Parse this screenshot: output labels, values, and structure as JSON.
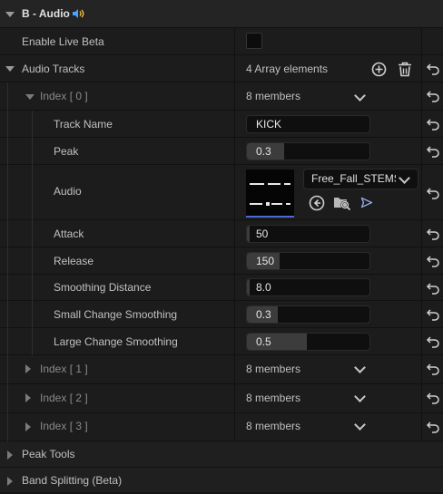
{
  "panel": {
    "section_title": "B - Audio",
    "section_icon": "speaker-icon",
    "enable_live_beta": {
      "label": "Enable Live Beta",
      "checked": false
    },
    "audio_tracks": {
      "label": "Audio Tracks",
      "count_text": "4 Array elements",
      "add_icon": "plus-circle-icon",
      "delete_icon": "trash-icon"
    },
    "index0": {
      "label": "Index [ 0 ]",
      "members": "8 members",
      "track_name": {
        "label": "Track Name",
        "value": "KICK"
      },
      "peak": {
        "label": "Peak",
        "value": "0.3",
        "fill": 0.3
      },
      "audio": {
        "label": "Audio",
        "asset": "Free_Fall_STEMS",
        "icons": [
          "use-selected-icon",
          "browse-folder-icon",
          "play-icon"
        ]
      },
      "attack": {
        "label": "Attack",
        "value": "50",
        "fill": 0.02
      },
      "release": {
        "label": "Release",
        "value": "150",
        "fill": 0.27
      },
      "smoothing_distance": {
        "label": "Smoothing Distance",
        "value": "8.0",
        "fill": 0.02
      },
      "small_change_smoothing": {
        "label": "Small Change Smoothing",
        "value": "0.3",
        "fill": 0.25
      },
      "large_change_smoothing": {
        "label": "Large Change Smoothing",
        "value": "0.5",
        "fill": 0.49
      }
    },
    "index1": {
      "label": "Index [ 1 ]",
      "members": "8 members"
    },
    "index2": {
      "label": "Index [ 2 ]",
      "members": "8 members"
    },
    "index3": {
      "label": "Index [ 3 ]",
      "members": "8 members"
    },
    "peak_tools": {
      "label": "Peak Tools"
    },
    "band_splitting": {
      "label": "Band Splitting (Beta)"
    },
    "reset_icon": "reset-arrow-icon",
    "colors": {
      "accent": "#4a6bd6",
      "field_bg": "#0f0f0f",
      "fill": "#3c3c3c"
    }
  }
}
